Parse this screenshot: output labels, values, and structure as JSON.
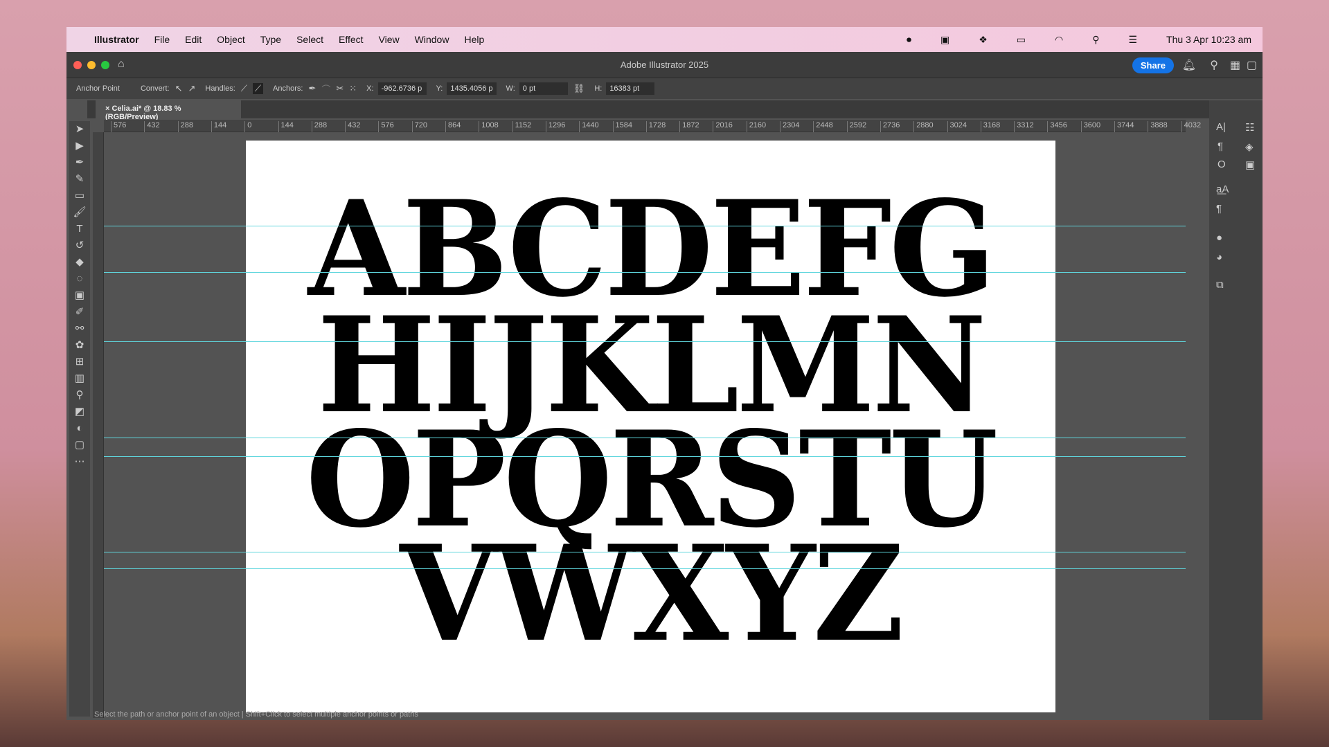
{
  "menubar": {
    "app": "Illustrator",
    "items": [
      "File",
      "Edit",
      "Object",
      "Type",
      "Select",
      "Effect",
      "View",
      "Window",
      "Help"
    ],
    "clock": "Thu 3 Apr  10:23 am"
  },
  "titlebar": {
    "title": "Adobe Illustrator 2025",
    "share": "Share"
  },
  "control": {
    "mode": "Anchor Point",
    "convert": "Convert:",
    "handles": "Handles:",
    "anchors": "Anchors:",
    "x_label": "X:",
    "x": "-962.6736 p",
    "y_label": "Y:",
    "y": "1435.4056 p",
    "w_label": "W:",
    "w": "0 pt",
    "h_label": "H:",
    "h": "16383 pt"
  },
  "document": {
    "tab": "Celia.ai* @ 18.83 % (RGB/Preview)"
  },
  "ruler": [
    "576",
    "432",
    "288",
    "144",
    "0",
    "144",
    "288",
    "432",
    "576",
    "720",
    "864",
    "1008",
    "1152",
    "1296",
    "1440",
    "1584",
    "1728",
    "1872",
    "2016",
    "2160",
    "2304",
    "2448",
    "2592",
    "2736",
    "2880",
    "3024",
    "3168",
    "3312",
    "3456",
    "3600",
    "3744",
    "3888",
    "4032"
  ],
  "artwork": {
    "rows": [
      "ABCDEFG",
      "HIJKLMN",
      "OPQRSTU",
      "VWXYZ"
    ]
  },
  "status": "Select the path or anchor point of an object | Shift+Click to select multiple anchor points or paths",
  "colors": {
    "share": "#1473e6",
    "guide": "#5fd6dd"
  }
}
